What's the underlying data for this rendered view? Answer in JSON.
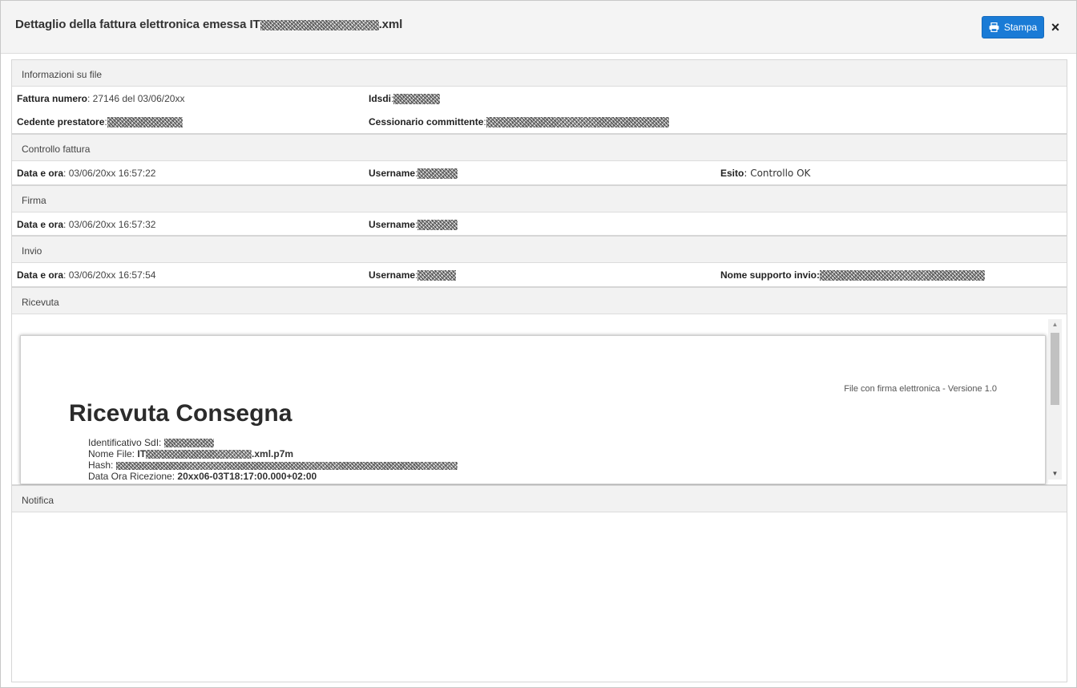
{
  "modal": {
    "title_prefix": "Dettaglio della fattura elettronica emessa IT",
    "title_suffix": ".xml",
    "print_label": "Stampa",
    "close_label": "×"
  },
  "file_info": {
    "heading": "Informazioni su file",
    "invoice_number_label": "Fattura numero",
    "invoice_number_value": ": 27146 del 03/06/20xx",
    "idsdi_label": "Idsdi",
    "idsdi_sep": ":",
    "supplier_label": "Cedente prestatore",
    "supplier_sep": ":",
    "customer_label": "Cessionario committente",
    "customer_sep": ":"
  },
  "check": {
    "heading": "Controllo fattura",
    "datetime_label": "Data e ora",
    "datetime_value": ": 03/06/20xx 16:57:22",
    "username_label": "Username",
    "username_sep": ":",
    "outcome_label": "Esito",
    "outcome_value": ": Controllo OK"
  },
  "signature": {
    "heading": "Firma",
    "datetime_label": "Data e ora",
    "datetime_value": ": 03/06/20xx 16:57:32",
    "username_label": "Username",
    "username_sep": ":"
  },
  "sending": {
    "heading": "Invio",
    "datetime_label": "Data e ora",
    "datetime_value": ": 03/06/20xx 16:57:54",
    "username_label": "Username",
    "username_sep": ":",
    "channel_label": "Nome supporto invio:",
    "channel_sep": ":"
  },
  "receipt": {
    "heading": "Ricevuta",
    "version": "File con firma elettronica - Versione 1.0",
    "title": "Ricevuta Consegna",
    "sdi_label": "Identificativo SdI: ",
    "filename_label": "Nome File: ",
    "filename_prefix": "IT",
    "filename_suffix": ".xml.p7m",
    "hash_label": "Hash: ",
    "received_label": "Data Ora Ricezione: ",
    "received_value": "20xx06-03T18:17:00.000+02:00"
  },
  "notification": {
    "heading": "Notifica"
  },
  "colors": {
    "print_button": "#1a7bd6",
    "panel_heading_bg": "#f2f2f2"
  },
  "icons": {
    "print": "printer-icon",
    "close": "close-icon"
  }
}
